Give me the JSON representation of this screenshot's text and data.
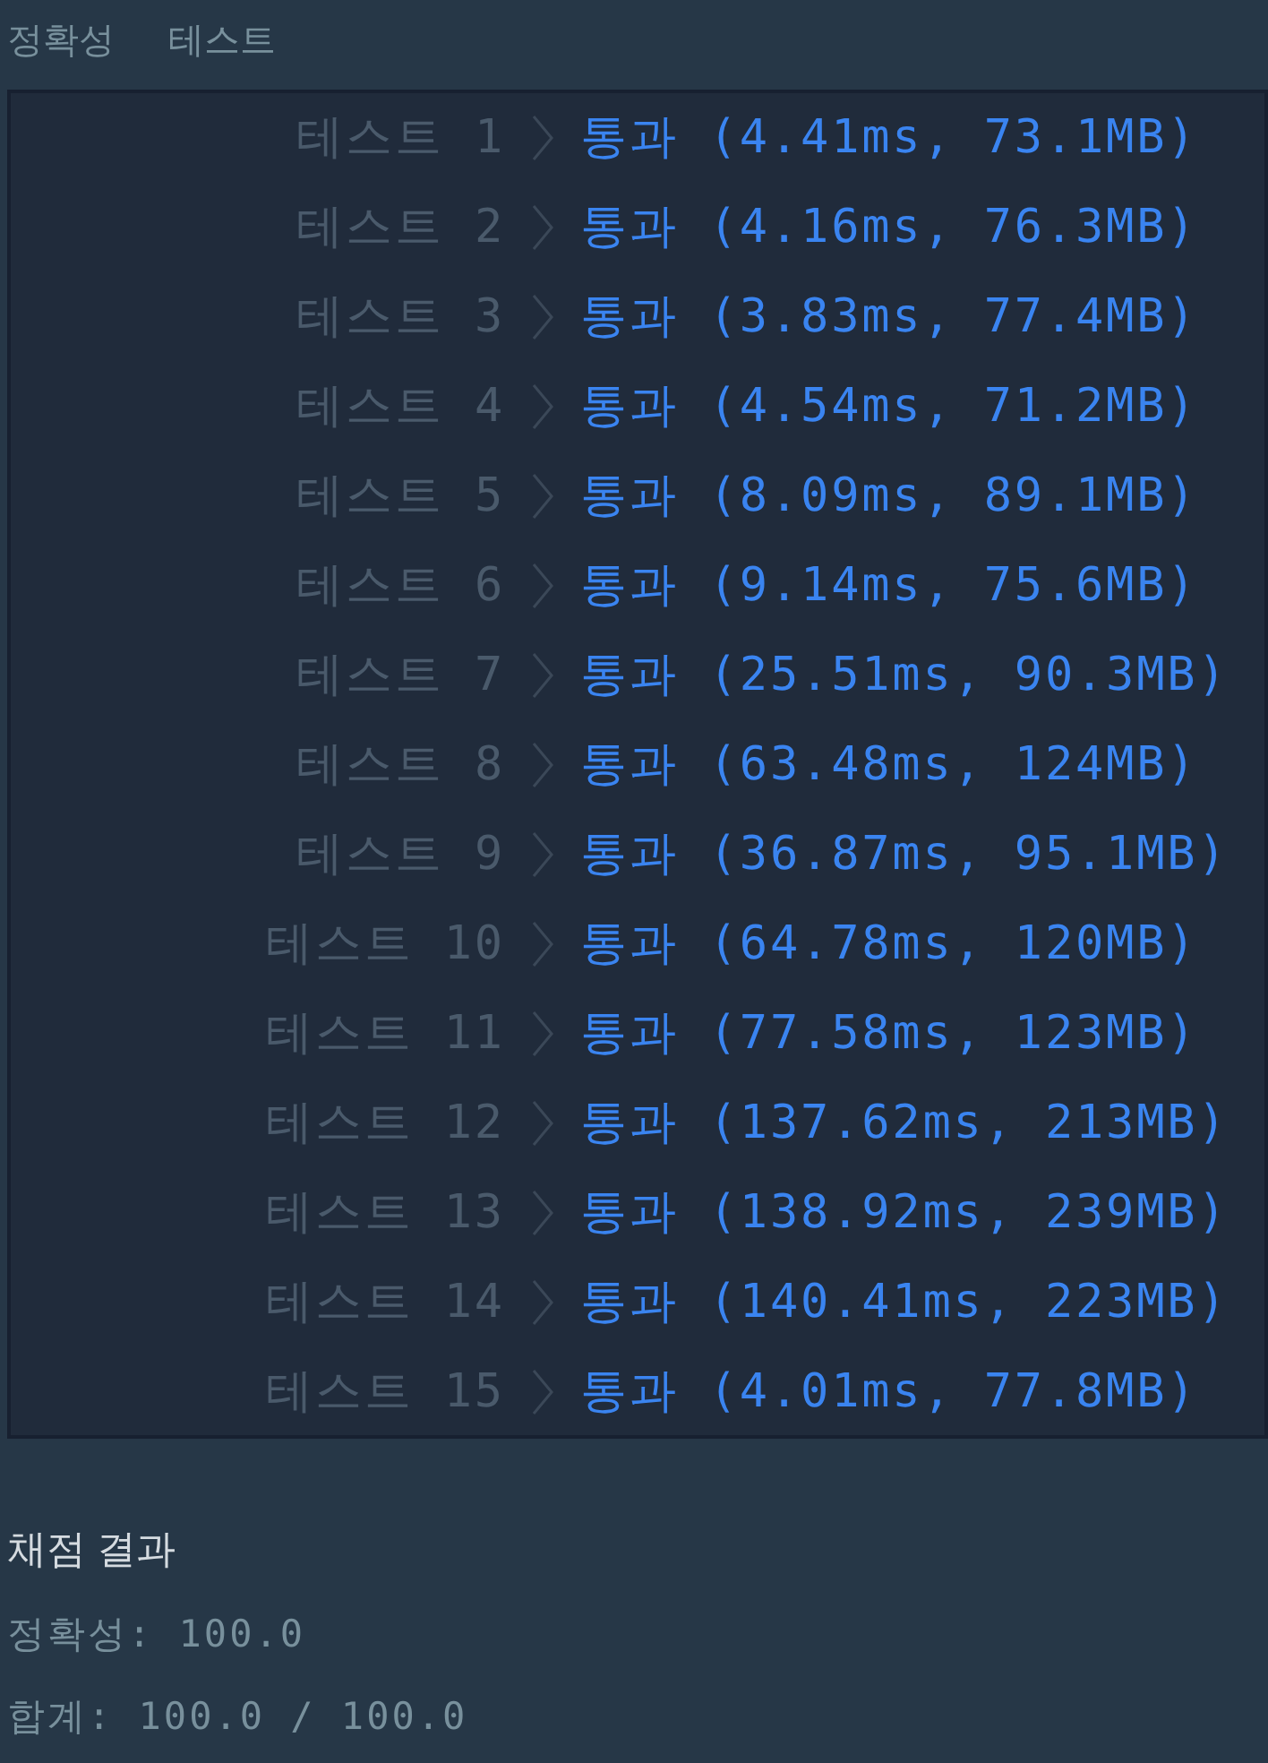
{
  "header": {
    "title": "정확성",
    "subtitle": "테스트"
  },
  "tests": [
    {
      "label": "테스트 1",
      "result": "통과 (4.41ms, 73.1MB)"
    },
    {
      "label": "테스트 2",
      "result": "통과 (4.16ms, 76.3MB)"
    },
    {
      "label": "테스트 3",
      "result": "통과 (3.83ms, 77.4MB)"
    },
    {
      "label": "테스트 4",
      "result": "통과 (4.54ms, 71.2MB)"
    },
    {
      "label": "테스트 5",
      "result": "통과 (8.09ms, 89.1MB)"
    },
    {
      "label": "테스트 6",
      "result": "통과 (9.14ms, 75.6MB)"
    },
    {
      "label": "테스트 7",
      "result": "통과 (25.51ms, 90.3MB)"
    },
    {
      "label": "테스트 8",
      "result": "통과 (63.48ms, 124MB)"
    },
    {
      "label": "테스트 9",
      "result": "통과 (36.87ms, 95.1MB)"
    },
    {
      "label": "테스트 10",
      "result": "통과 (64.78ms, 120MB)"
    },
    {
      "label": "테스트 11",
      "result": "통과 (77.58ms, 123MB)"
    },
    {
      "label": "테스트 12",
      "result": "통과 (137.62ms, 213MB)"
    },
    {
      "label": "테스트 13",
      "result": "통과 (138.92ms, 239MB)"
    },
    {
      "label": "테스트 14",
      "result": "통과 (140.41ms, 223MB)"
    },
    {
      "label": "테스트 15",
      "result": "통과 (4.01ms, 77.8MB)"
    }
  ],
  "summary": {
    "title": "채점 결과",
    "lines": [
      "정확성: 100.0",
      "합계: 100.0 / 100.0"
    ]
  }
}
